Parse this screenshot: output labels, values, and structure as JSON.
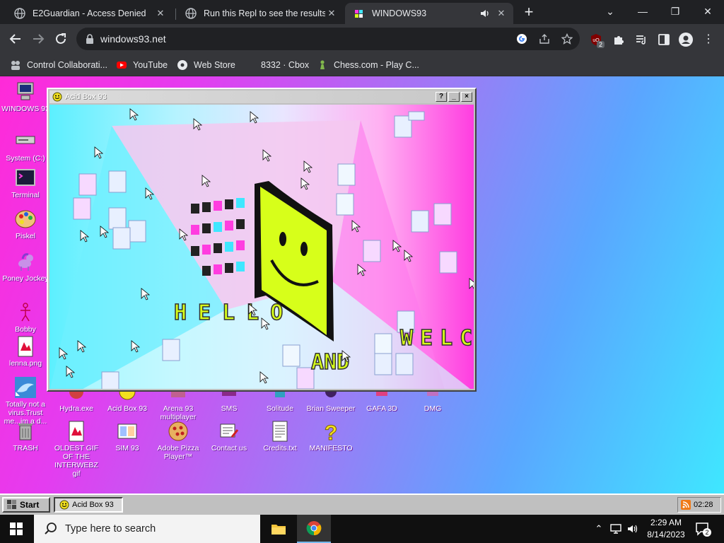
{
  "browser": {
    "tabs": [
      {
        "title": "E2Guardian - Access Denied",
        "active": false
      },
      {
        "title": "Run this Repl to see the results h",
        "active": false
      },
      {
        "title": "WINDOWS93",
        "active": true
      }
    ],
    "url": "windows93.net",
    "extension_badge": "2",
    "bookmarks": [
      {
        "label": "Control Collaborati...",
        "icon": "collab-icon"
      },
      {
        "label": "YouTube",
        "icon": "youtube-icon"
      },
      {
        "label": "Web Store",
        "icon": "webstore-icon"
      },
      {
        "label": "8332 · Cbox",
        "icon": "cbox-icon"
      },
      {
        "label": "Chess.com - Play C...",
        "icon": "chess-icon"
      }
    ]
  },
  "desktop": {
    "left_icons": [
      {
        "label": "WINDOWS 93",
        "icon": "computer-icon"
      },
      {
        "label": "System (C:)",
        "icon": "drive-icon"
      },
      {
        "label": "Terminal",
        "icon": "terminal-icon"
      },
      {
        "label": "Piskel",
        "icon": "palette-icon"
      },
      {
        "label": "Poney Jockey",
        "icon": "pony-icon"
      },
      {
        "label": "Bobby",
        "icon": "stickman-icon"
      },
      {
        "label": "lenna.png",
        "icon": "image-file-icon"
      },
      {
        "label": "Totally not a virus.Trust me...im a d...",
        "icon": "dolphin-icon"
      }
    ],
    "bottom_icons_row1": [
      {
        "label": "Hydra.exe",
        "icon": "hydra-icon"
      },
      {
        "label": "Acid Box 93",
        "icon": "acid-icon"
      },
      {
        "label": "Arena 93 multiplayer",
        "icon": "arena-icon"
      },
      {
        "label": "SMS",
        "icon": "sms-icon"
      },
      {
        "label": "Solitude",
        "icon": "solitude-icon"
      },
      {
        "label": "Brian Sweeper",
        "icon": "sweeper-icon"
      },
      {
        "label": "GAFA 3D",
        "icon": "gafa-icon"
      },
      {
        "label": "DMG",
        "icon": "dmg-icon"
      }
    ],
    "bottom_icons_row2": [
      {
        "label": "TRASH",
        "icon": "trash-icon"
      },
      {
        "label": "OLDEST GIF OF THE INTERWEBZ gif",
        "icon": "gif-file-icon"
      },
      {
        "label": "SIM 93",
        "icon": "sim-icon"
      },
      {
        "label": "Adobe Pizza Player™",
        "icon": "pizza-icon"
      },
      {
        "label": "Contact us",
        "icon": "contact-icon"
      },
      {
        "label": "Credits.txt",
        "icon": "text-file-icon"
      },
      {
        "label": "MANIFESTO",
        "icon": "question-icon"
      }
    ]
  },
  "acid_window": {
    "title": "Acid Box 93",
    "buttons": [
      "?",
      "_",
      "×"
    ],
    "scene_text": [
      "HELLO",
      "AND",
      "WELC"
    ]
  },
  "w93_taskbar": {
    "start_label": "Start",
    "task_label": "Acid Box 93",
    "tray_time": "02:28"
  },
  "win10_taskbar": {
    "search_placeholder": "Type here to search",
    "time": "2:29 AM",
    "date": "8/14/2023",
    "notification_count": "2"
  },
  "colors": {
    "chrome_dark": "#202124",
    "chrome_toolbar": "#35363a",
    "desktop_pink": "#ff2ad8",
    "desktop_cyan": "#3fe7ff",
    "w93_gray": "#c0c0c0",
    "acid_smiley": "#d7ff1a"
  }
}
